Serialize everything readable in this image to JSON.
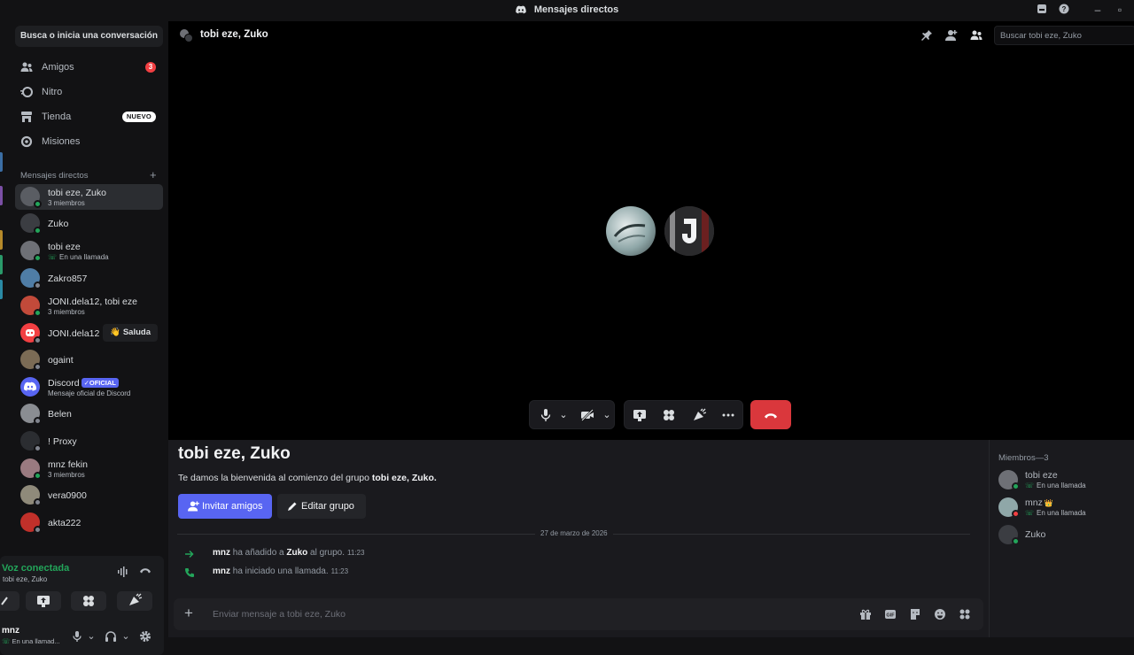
{
  "window": {
    "title": "Mensajes directos"
  },
  "sidebar": {
    "search_label": "Busca o inicia una conversación",
    "nav": [
      {
        "label": "Amigos",
        "icon": "friends-icon",
        "badge": "3"
      },
      {
        "label": "Nitro",
        "icon": "nitro-icon"
      },
      {
        "label": "Tienda",
        "icon": "shop-icon",
        "badge_new": "NUEVO"
      },
      {
        "label": "Misiones",
        "icon": "quests-icon"
      }
    ],
    "dm_header": "Mensajes directos",
    "dms": [
      {
        "name": "tobi eze, Zuko",
        "sub": "3 miembros",
        "color": "#5a5d63",
        "status": "#23a55a"
      },
      {
        "name": "Zuko",
        "sub": "",
        "color": "#3b3d42",
        "status": "#23a55a"
      },
      {
        "name": "tobi eze",
        "sub": "En una llamada",
        "call": true,
        "color": "#6e7076",
        "status": "#23a55a"
      },
      {
        "name": "Zakro857",
        "sub": "",
        "color": "#4f7da6",
        "status": "#80848e"
      },
      {
        "name": "JONI.dela12, tobi eze",
        "sub": "3 miembros",
        "color": "#c24a3a",
        "status": "#23a55a"
      },
      {
        "name": "JONI.dela12",
        "sub": "",
        "color": "#f23f42",
        "status": "#80848e",
        "action": "Saluda"
      },
      {
        "name": "ogaint",
        "sub": "",
        "color": "#7b6b55",
        "status": "#80848e"
      },
      {
        "name": "Discord",
        "sub": "Mensaje oficial de Discord",
        "badge": "OFICIAL",
        "color": "#5865f2"
      },
      {
        "name": "Belen",
        "sub": "",
        "color": "#8a8d92",
        "status": "#80848e"
      },
      {
        "name": "! Proxy",
        "sub": "",
        "color": "#2b2d31",
        "status": "#80848e"
      },
      {
        "name": "mnz fekin",
        "sub": "3 miembros",
        "color": "#9a7a80",
        "status": "#23a55a"
      },
      {
        "name": "vera0900",
        "sub": "",
        "color": "#8f8a7a",
        "status": "#80848e"
      },
      {
        "name": "akta222",
        "sub": "",
        "color": "#c0302a",
        "status": "#80848e"
      }
    ]
  },
  "voice": {
    "title": "Voz conectada",
    "channel": "tobi eze, Zuko"
  },
  "user": {
    "name": "mnz",
    "status": "En una llamad..."
  },
  "call": {
    "title": "tobi eze, Zuko",
    "search_placeholder": "Buscar tobi eze, Zuko"
  },
  "chat": {
    "title": "tobi eze, Zuko",
    "welcome_prefix": "Te damos la bienvenida al comienzo del grupo ",
    "welcome_group": "tobi eze, Zuko.",
    "invite_label": "Invitar amigos",
    "edit_label": "Editar grupo",
    "date": "27 de marzo de 2026",
    "messages": [
      {
        "user": "mnz",
        "text1": " ha añadido a ",
        "target": "Zuko",
        "text2": " al grupo.",
        "time": "11:23"
      },
      {
        "user": "mnz",
        "text1": " ha iniciado una llamada.",
        "time": "11:23"
      }
    ],
    "input_placeholder": "Enviar mensaje a tobi eze, Zuko"
  },
  "members": {
    "header": "Miembros—3",
    "list": [
      {
        "name": "tobi eze",
        "sub": "En una llamada",
        "color": "#6e7076",
        "status": "#23a55a"
      },
      {
        "name": "mnz",
        "crown": "👑",
        "sub": "En una llamada",
        "color": "#8fa7a8",
        "status": "#f23f42"
      },
      {
        "name": "Zuko",
        "sub": "",
        "color": "#3b3d42",
        "status": "#23a55a"
      }
    ]
  },
  "colors": {
    "accent": "#5865f2",
    "online": "#23a55a",
    "danger": "#da373c"
  }
}
